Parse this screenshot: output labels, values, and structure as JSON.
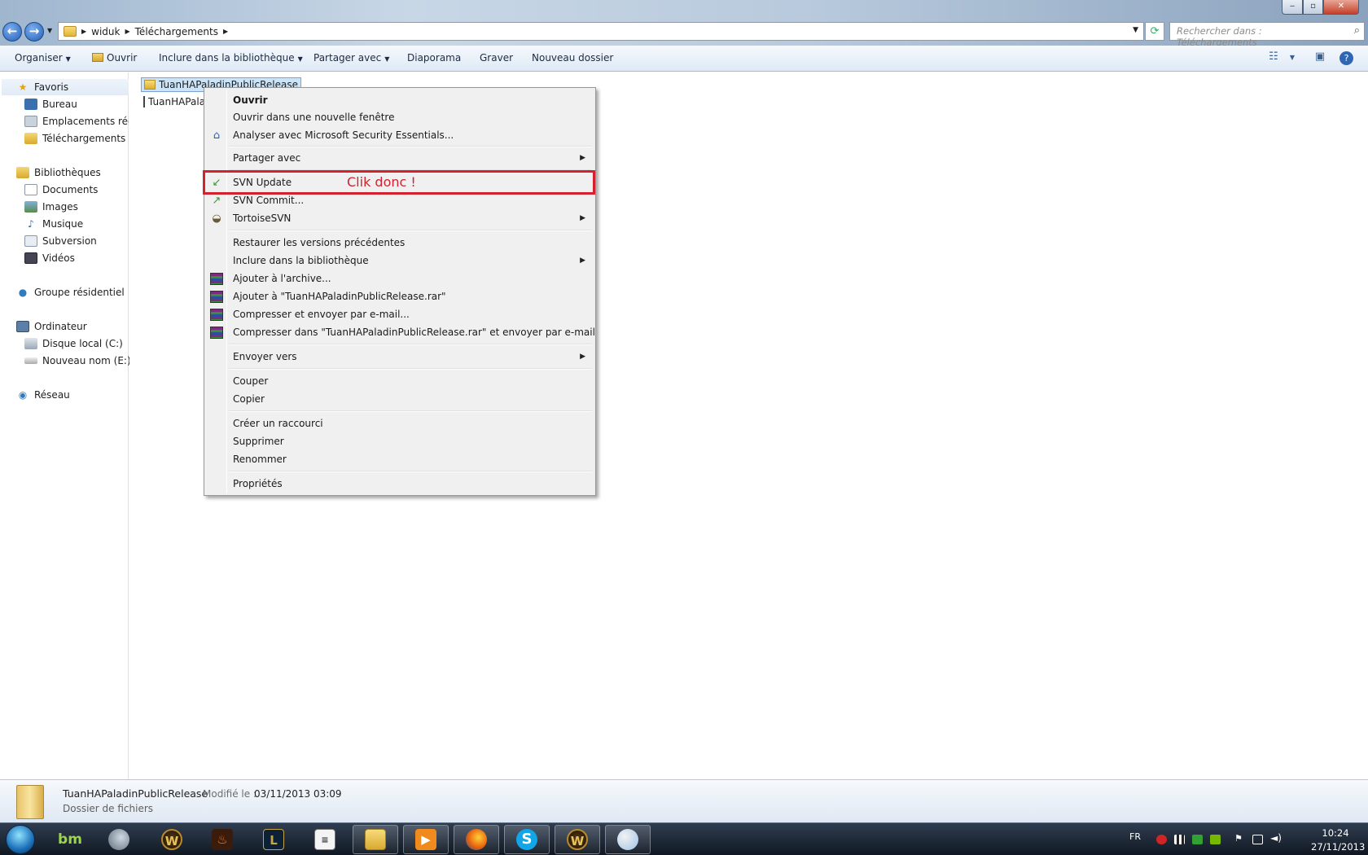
{
  "window": {
    "controls": {
      "minimize": "‒",
      "maximize": "▫",
      "close": "✕"
    }
  },
  "address_bar": {
    "breadcrumb": [
      "widuk",
      "Téléchargements"
    ],
    "search_placeholder": "Rechercher dans : Téléchargements"
  },
  "toolbar": {
    "organiser": "Organiser",
    "ouvrir": "Ouvrir",
    "inclure": "Inclure dans la bibliothèque",
    "partager": "Partager avec",
    "diaporama": "Diaporama",
    "graver": "Graver",
    "nouveau_dossier": "Nouveau dossier"
  },
  "sidebar": {
    "favoris": "Favoris",
    "bureau": "Bureau",
    "emplacements": "Emplacements récer",
    "telechargements": "Téléchargements",
    "bibliotheques": "Bibliothèques",
    "documents": "Documents",
    "images": "Images",
    "musique": "Musique",
    "subversion": "Subversion",
    "videos": "Vidéos",
    "groupe": "Groupe résidentiel",
    "ordinateur": "Ordinateur",
    "disque_c": "Disque local (C:)",
    "nouveau_e": "Nouveau nom (E:)",
    "reseau": "Réseau"
  },
  "files": {
    "folder": "TuanHAPaladinPublicRelease",
    "rar": "TuanHAPaladinPublicRelease.rar"
  },
  "context_menu": {
    "ouvrir": "Ouvrir",
    "nouvelle_fenetre": "Ouvrir dans une nouvelle fenêtre",
    "analyser": "Analyser avec Microsoft Security Essentials...",
    "partager": "Partager avec",
    "svn_update": "SVN Update",
    "svn_commit": "SVN Commit...",
    "tortoise": "TortoiseSVN",
    "restaurer": "Restaurer les versions précédentes",
    "inclure": "Inclure dans la bibliothèque",
    "ajouter_archive": "Ajouter à l'archive...",
    "ajouter_rar": "Ajouter à \"TuanHAPaladinPublicRelease.rar\"",
    "compresser_mail": "Compresser et envoyer par e-mail...",
    "compresser_rar_mail": "Compresser dans \"TuanHAPaladinPublicRelease.rar\" et envoyer par e-mail",
    "envoyer_vers": "Envoyer vers",
    "couper": "Couper",
    "copier": "Copier",
    "raccourci": "Créer un raccourci",
    "supprimer": "Supprimer",
    "renommer": "Renommer",
    "proprietes": "Propriétés",
    "annotation": "Clik donc !"
  },
  "details": {
    "name": "TuanHAPaladinPublicRelease",
    "modified_label": "Modifié le :",
    "modified_value": "03/11/2013 03:09",
    "type": "Dossier de fichiers"
  },
  "taskbar": {
    "lang": "FR",
    "time": "10:24",
    "date": "27/11/2013",
    "apps": [
      "W",
      "bm",
      "L",
      "S",
      "W"
    ]
  },
  "colors": {
    "highlight_box": "#d2222d",
    "selection": "#cce4f7",
    "toolbar_bg": "#dfe9f5"
  }
}
